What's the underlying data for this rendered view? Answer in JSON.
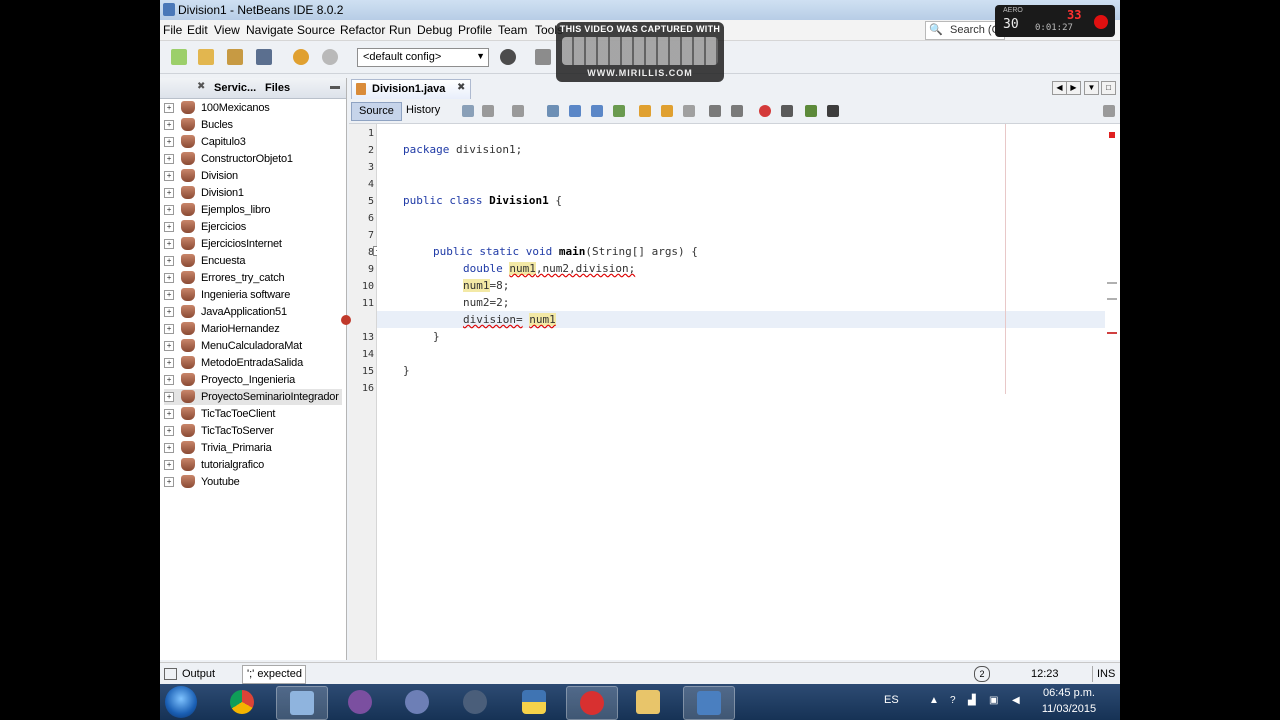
{
  "window": {
    "title": "Division1 - NetBeans IDE 8.0.2"
  },
  "menu": [
    "File",
    "Edit",
    "View",
    "Navigate",
    "Source",
    "Refactor",
    "Run",
    "Debug",
    "Profile",
    "Team",
    "Tools"
  ],
  "search": {
    "label": "Search (C"
  },
  "toolbar": {
    "config": "<default config>"
  },
  "left_panel": {
    "tabs": [
      "Servic...",
      "Files"
    ],
    "projects": [
      "100Mexicanos",
      "Bucles",
      "Capitulo3",
      "ConstructorObjeto1",
      "Division",
      "Division1",
      "Ejemplos_libro",
      "Ejercicios",
      "EjerciciosInternet",
      "Encuesta",
      "Errores_try_catch",
      "Ingenieria software",
      "JavaApplication51",
      "MarioHernandez",
      "MenuCalculadoraMat",
      "MetodoEntradaSalida",
      "Proyecto_Ingenieria",
      "ProyectoSeminarioIntegrador",
      "TicTacToeClient",
      "TicTacToServer",
      "Trivia_Primaria",
      "tutorialgrafico",
      "Youtube"
    ],
    "selected": "ProyectoSeminarioIntegrador"
  },
  "editor": {
    "file_tab": "Division1.java",
    "view_tabs": {
      "source": "Source",
      "history": "History"
    },
    "line_numbers": [
      "1",
      "2",
      "3",
      "4",
      "5",
      "6",
      "7",
      "8",
      "9",
      "10",
      "11",
      "12",
      "13",
      "14",
      "15",
      "16"
    ],
    "code": {
      "l2_kw": "package",
      "l2_rest": " division1;",
      "l5_kw": "public class",
      "l5_name": "Division1",
      "l5_rest": " {",
      "l8_kw": "public static void",
      "l8_name": "main",
      "l8_rest": "(String[] args) {",
      "l9_kw": "double",
      "l9_a": "num1",
      "l9_b": ",num2,division;",
      "l10_a": "num1",
      "l10_b": "=8;",
      "l11": "num2=2;",
      "l12_a": "division=",
      "l12_b": "num1",
      "l13": "}",
      "l15": "}"
    }
  },
  "status": {
    "output": "Output",
    "expected": "';' expected",
    "position": "12:23",
    "mode": "INS"
  },
  "taskbar": {
    "language": "ES",
    "time": "06:45 p.m.",
    "date": "11/03/2015"
  },
  "watermark": {
    "caption": "THIS VIDEO WAS CAPTURED WITH",
    "site": "WWW.MIRILLIS.COM"
  },
  "recorder": {
    "aero": "AERO",
    "fps": "30",
    "counter": "33",
    "timer": "0:01:27"
  }
}
